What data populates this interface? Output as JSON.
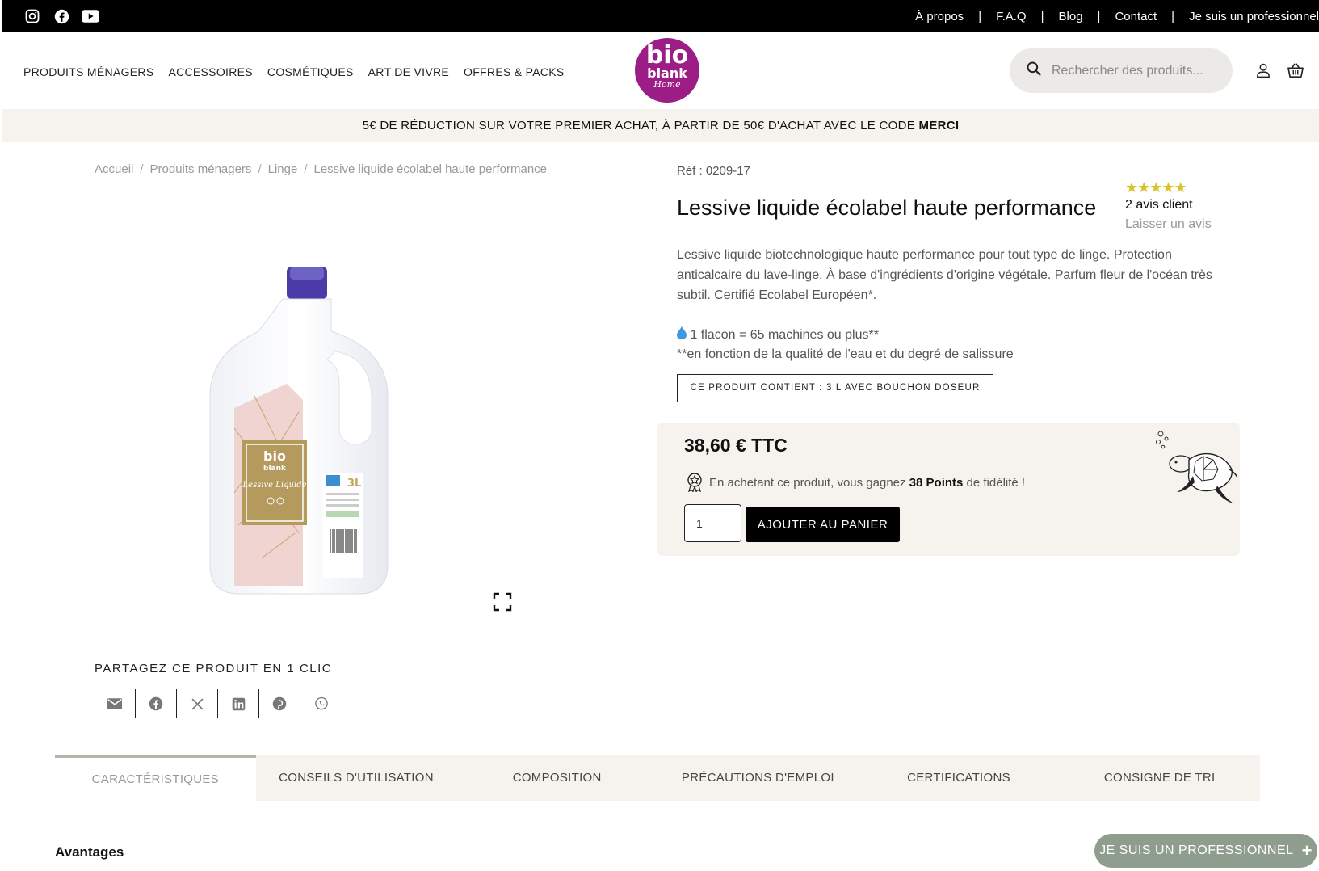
{
  "topbar": {
    "social": [
      "instagram-icon",
      "facebook-icon",
      "youtube-icon"
    ],
    "links": [
      "À propos",
      "F.A.Q",
      "Blog",
      "Contact",
      "Je suis un professionnel"
    ],
    "separator": "|"
  },
  "nav": {
    "items": [
      "PRODUITS MÉNAGERS",
      "ACCESSOIRES",
      "COSMÉTIQUES",
      "ART DE VIVRE",
      "OFFRES & PACKS"
    ]
  },
  "logo": {
    "line1": "bio",
    "line2": "blank",
    "line3": "Home",
    "color": "#9c1d86"
  },
  "search": {
    "placeholder": "Rechercher des produits..."
  },
  "promo": {
    "text": "5€ DE RÉDUCTION SUR VOTRE PREMIER ACHAT, À PARTIR DE 50€ D'ACHAT AVEC LE CODE ",
    "code": "MERCI"
  },
  "breadcrumb": [
    "Accueil",
    "Produits ménagers",
    "Linge",
    "Lessive liquide écolabel haute performance"
  ],
  "product": {
    "ref": "Réf : 0209-17",
    "title": "Lessive liquide écolabel haute performance",
    "stars": "★★★★★",
    "reviews": "2 avis client",
    "leave_review": "Laisser un avis",
    "description": "Lessive liquide biotechnologique haute performance pour tout type de linge. Protection anticalcaire du lave-linge. À base d'ingrédients d'origine végétale. Parfum fleur de l'océan très subtil. Certifié Ecolabel Européen*.",
    "machines": "1 flacon = 65 machines ou plus**",
    "machines_note": "**en fonction de la qualité de l'eau et du degré de salissure",
    "contains": "CE PRODUIT CONTIENT : 3 L AVEC BOUCHON DOSEUR",
    "price": "38,60 € TTC",
    "points_prefix": "En achetant ce produit, vous gagnez ",
    "points_value": "38 Points",
    "points_suffix": " de fidélité !",
    "quantity": "1",
    "add_to_cart": "AJOUTER AU PANIER",
    "label_brand1": "bio",
    "label_brand2": "blank",
    "label_name": "Lessive Liquide",
    "label_volume": "3L",
    "star_color": "#d8c32a"
  },
  "share": {
    "title": "PARTAGEZ CE PRODUIT EN 1 CLIC",
    "icons": [
      "email-icon",
      "facebook-icon",
      "x-icon",
      "linkedin-icon",
      "pinterest-icon",
      "whatsapp-icon"
    ]
  },
  "tabs": [
    "CARACTÉRISTIQUES",
    "CONSEILS D'UTILISATION",
    "COMPOSITION",
    "PRÉCAUTIONS D'EMPLOI",
    "CERTIFICATIONS",
    "CONSIGNE DE TRI"
  ],
  "section_title": "Avantages",
  "pro_button": {
    "label": "JE SUIS UN PROFESSIONNEL",
    "icon": "+"
  }
}
